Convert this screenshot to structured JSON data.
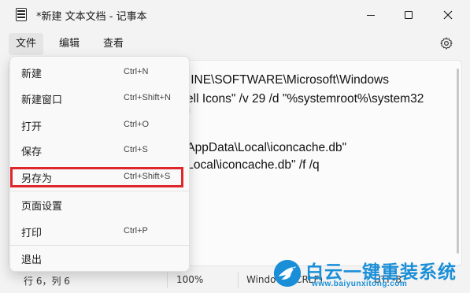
{
  "window": {
    "title": "*新建 文本文档 - 记事本"
  },
  "menubar": {
    "items": [
      "文件",
      "编辑",
      "查看"
    ]
  },
  "editor": {
    "lines": [
      "HINE\\SOFTWARE\\Microsoft\\Windows",
      "ell Icons\" /v 29 /d \"%systemroot%\\system32",
      "f",
      "",
      "\\AppData\\Local\\iconcache.db\"",
      "\\Local\\iconcache.db\" /f /q"
    ]
  },
  "file_menu": {
    "items": [
      {
        "label": "新建",
        "shortcut": "Ctrl+N"
      },
      {
        "label": "新建窗口",
        "shortcut": "Ctrl+Shift+N"
      },
      {
        "label": "打开",
        "shortcut": "Ctrl+O"
      },
      {
        "label": "保存",
        "shortcut": "Ctrl+S"
      },
      {
        "label": "另存为",
        "shortcut": "Ctrl+Shift+S"
      },
      {
        "label": "页面设置",
        "shortcut": ""
      },
      {
        "label": "打印",
        "shortcut": "Ctrl+P"
      },
      {
        "label": "退出",
        "shortcut": ""
      }
    ],
    "highlight_color": "#e0262d"
  },
  "statusbar": {
    "position": "行 6，列 6",
    "zoom": "100%",
    "line_ending": "Windows (CRLF)",
    "encoding": "UTF-8"
  },
  "watermark": {
    "name": "白云一键重装系统",
    "url": "www.baiyunxitong.com",
    "color": "#1a8fd8"
  }
}
